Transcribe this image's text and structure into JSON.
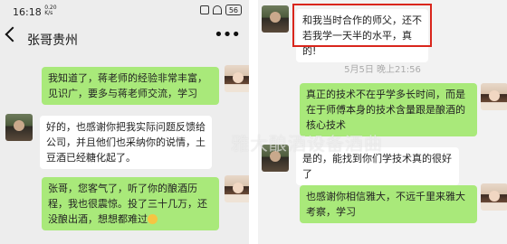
{
  "status_bar": {
    "time": "16:18",
    "net_speed": "0.20",
    "net_unit": "K/s",
    "battery": "56"
  },
  "left": {
    "title": "张哥贵州",
    "messages": [
      "我知道了，蒋老师的经验非常丰富，见识广，要多与蒋老师交流，学习",
      "好的，也感谢你把我实际问题反馈给公司，并且他们也采纳你的说情，土豆酒已经糖化起了。",
      "张哥，您客气了，听了你的酿酒历程，我也很震惊。投了三十几万，还没酿出酒，想想都难过"
    ]
  },
  "right": {
    "messages": [
      "和我当时合作的师父，还不若我学一天半的水平，真的!",
      "真正的技术不在乎学多长时间，而是在于师傅本身的技术含量跟是酿酒的核心技术",
      "是的，能找到你们学技术真的很好了",
      "也感谢你相信雅大，不远千里来雅大考察，学习"
    ],
    "timestamp": "5月5日 晚上21:56"
  },
  "watermark": "雅大酿酒设备酒曲",
  "colors": {
    "outgoing_bubble": "#a9e97a",
    "incoming_bubble": "#ffffff",
    "highlight": "#d9261c",
    "background": "#ededed"
  }
}
